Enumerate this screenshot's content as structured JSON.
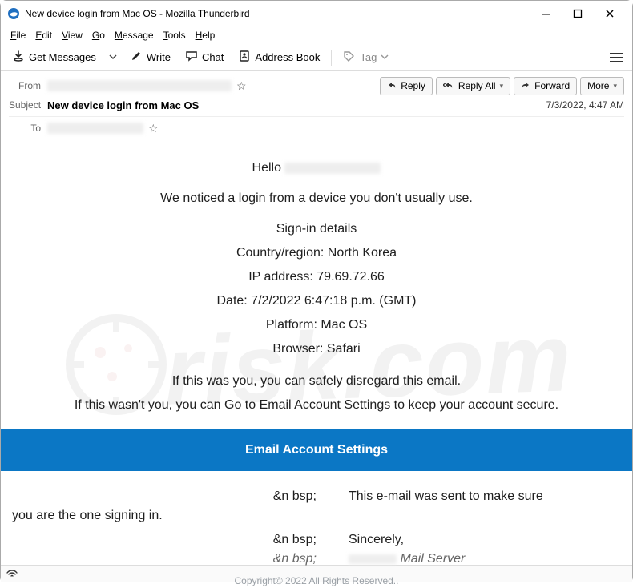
{
  "window": {
    "title": "New device login from Mac OS - Mozilla Thunderbird"
  },
  "menubar": {
    "file": "File",
    "edit": "Edit",
    "view": "View",
    "go": "Go",
    "message": "Message",
    "tools": "Tools",
    "help": "Help"
  },
  "toolbar": {
    "get_messages": "Get Messages",
    "write": "Write",
    "chat": "Chat",
    "address_book": "Address Book",
    "tag": "Tag"
  },
  "header": {
    "from_label": "From",
    "subject_label": "Subject",
    "to_label": "To",
    "subject_value": "New device login from Mac OS",
    "timestamp": "7/3/2022, 4:47 AM",
    "actions": {
      "reply": "Reply",
      "reply_all": "Reply All",
      "forward": "Forward",
      "more": "More"
    }
  },
  "body": {
    "hello": "Hello",
    "noticed": "We noticed a login from a device you don't usually use.",
    "signin_details": "Sign-in details",
    "country_line": "Country/region: North Korea",
    "ip_line": "IP address: 79.69.72.66",
    "date_line": "Date: 7/2/2022 6:47:18 p.m. (GMT)",
    "platform_line": "Platform: Mac OS",
    "browser_line": "Browser: Safari",
    "was_you": "If this was you, you can safely disregard this email.",
    "wasnt_you": "If this wasn't you, you can Go to Email Account Settings to keep your account secure.",
    "cta": "Email Account Settings",
    "nbsp": "&n bsp;",
    "sent_make_sure_part": "This e-mail was sent to make sure",
    "you_are_signing": "you are the one signing in.",
    "sincerely": "Sincerely,",
    "mail_server": "Mail Server",
    "copyright": "Copyright© 2022 All Rights Reserved.."
  }
}
